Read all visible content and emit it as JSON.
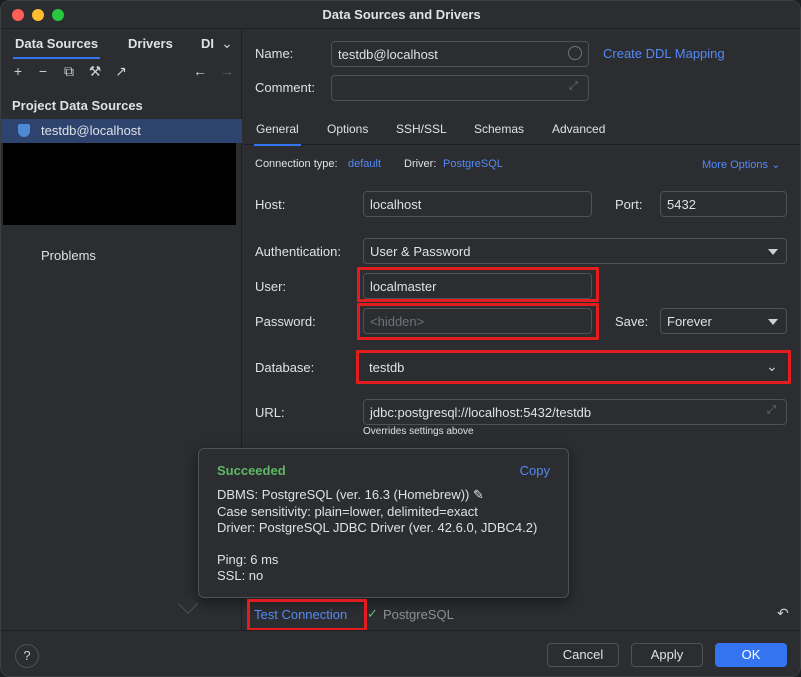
{
  "window": {
    "title": "Data Sources and Drivers"
  },
  "sidebar": {
    "tabs": [
      "Data Sources",
      "Drivers",
      "DI"
    ],
    "section_title": "Project Data Sources",
    "selected_item": "testdb@localhost",
    "problems_label": "Problems"
  },
  "header": {
    "name_label": "Name:",
    "name_value": "testdb@localhost",
    "create_ddl_link": "Create DDL Mapping",
    "comment_label": "Comment:",
    "comment_value": ""
  },
  "tabs": [
    "General",
    "Options",
    "SSH/SSL",
    "Schemas",
    "Advanced"
  ],
  "general": {
    "connection_type_label": "Connection type:",
    "connection_type_value": "default",
    "driver_label": "Driver:",
    "driver_value": "PostgreSQL",
    "more_options": "More Options",
    "host_label": "Host:",
    "host_value": "localhost",
    "port_label": "Port:",
    "port_value": "5432",
    "auth_label": "Authentication:",
    "auth_value": "User & Password",
    "user_label": "User:",
    "user_value": "localmaster",
    "password_label": "Password:",
    "password_placeholder": "<hidden>",
    "save_label": "Save:",
    "save_value": "Forever",
    "database_label": "Database:",
    "database_value": "testdb",
    "url_label": "URL:",
    "url_value": "jdbc:postgresql://localhost:5432/testdb",
    "url_hint": "Overrides settings above"
  },
  "popup": {
    "status": "Succeeded",
    "copy": "Copy",
    "dbms": "DBMS: PostgreSQL (ver. 16.3 (Homebrew))",
    "case_sensitivity": "Case sensitivity: plain=lower, delimited=exact",
    "driver": "Driver: PostgreSQL JDBC Driver (ver. 42.6.0, JDBC4.2)",
    "ping": "Ping: 6 ms",
    "ssl": "SSL: no"
  },
  "footer": {
    "test_connection": "Test Connection",
    "driver_status": "PostgreSQL",
    "cancel": "Cancel",
    "apply": "Apply",
    "ok": "OK",
    "help": "?"
  },
  "colors": {
    "accent": "#3574f0",
    "link": "#548af7",
    "success": "#5fb865",
    "highlight": "#e11d1d"
  }
}
